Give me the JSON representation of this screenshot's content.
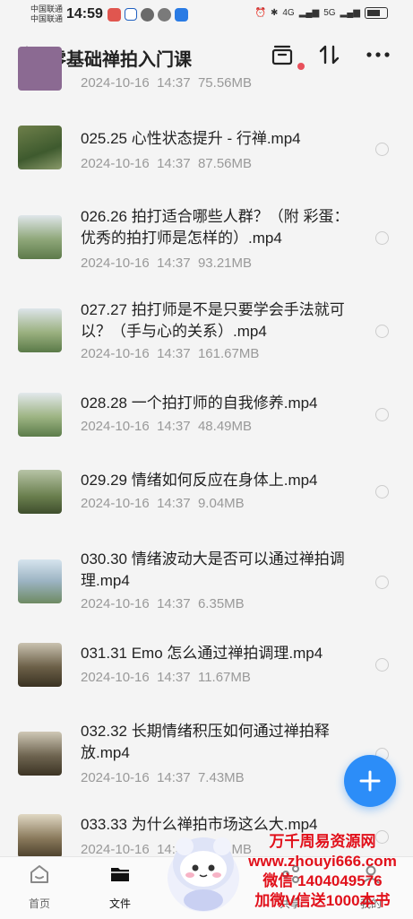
{
  "status": {
    "carrier1": "中国联通",
    "carrier2": "中国联通",
    "time": "14:59",
    "signal1": "4G",
    "signal2": "5G"
  },
  "header": {
    "title": "零基础禅拍入门课"
  },
  "items": [
    {
      "name": "",
      "date": "2024-10-16",
      "time": "14:37",
      "size": "75.56MB"
    },
    {
      "name": "025.25 心性状态提升 - 行禅.mp4",
      "date": "2024-10-16",
      "time": "14:37",
      "size": "87.56MB"
    },
    {
      "name": "026.26 拍打适合哪些人群？（附 彩蛋：优秀的拍打师是怎样的）.mp4",
      "date": "2024-10-16",
      "time": "14:37",
      "size": "93.21MB"
    },
    {
      "name": "027.27 拍打师是不是只要学会手法就可以？（手与心的关系）.mp4",
      "date": "2024-10-16",
      "time": "14:37",
      "size": "161.67MB"
    },
    {
      "name": "028.28 一个拍打师的自我修养.mp4",
      "date": "2024-10-16",
      "time": "14:37",
      "size": "48.49MB"
    },
    {
      "name": "029.29 情绪如何反应在身体上.mp4",
      "date": "2024-10-16",
      "time": "14:37",
      "size": "9.04MB"
    },
    {
      "name": "030.30 情绪波动大是否可以通过禅拍调理.mp4",
      "date": "2024-10-16",
      "time": "14:37",
      "size": "6.35MB"
    },
    {
      "name": "031.31 Emo 怎么通过禅拍调理.mp4",
      "date": "2024-10-16",
      "time": "14:37",
      "size": "11.67MB"
    },
    {
      "name": "032.32 长期情绪积压如何通过禅拍释放.mp4",
      "date": "2024-10-16",
      "time": "14:37",
      "size": "7.43MB"
    },
    {
      "name": "033.33 为什么禅拍市场这么大.mp4",
      "date": "2024-10-16",
      "time": "14:37",
      "size": "93.32MB"
    }
  ],
  "tabs": [
    {
      "label": "首页"
    },
    {
      "label": "文件"
    },
    {
      "label": "共享"
    },
    {
      "label": "我的"
    }
  ],
  "watermark": {
    "line1": "万千周易资源网",
    "line2": "www.zhouyi666.com",
    "line3": "微信 1404049576",
    "line4": "加微V信送1000本书"
  },
  "colors": {
    "accent": "#2c8df8",
    "watermark": "#e1101a",
    "badge": "#e8505b"
  }
}
